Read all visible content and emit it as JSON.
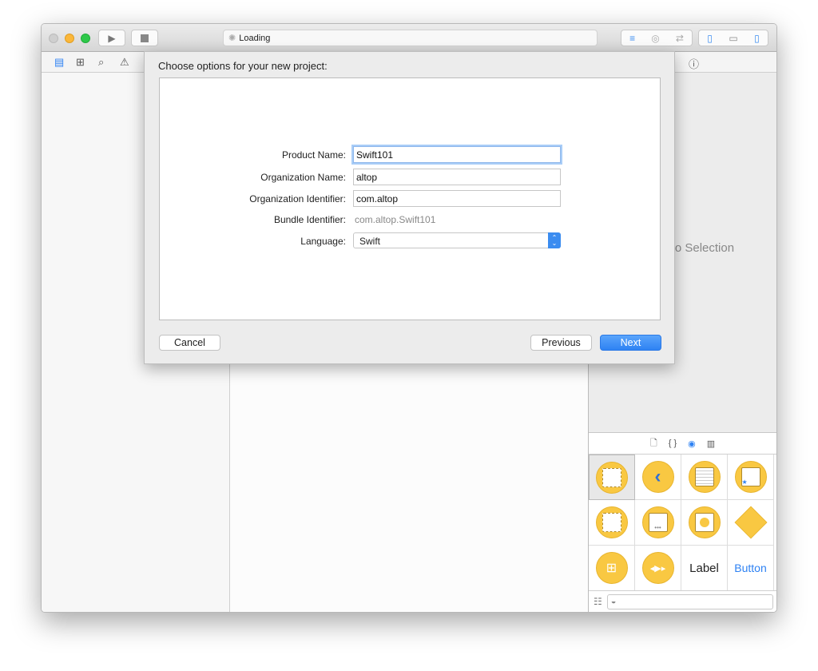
{
  "toolbar": {
    "activity": "Loading"
  },
  "inspector": {
    "empty_text": "No Selection"
  },
  "library": {
    "text_items": [
      "Label",
      "Button"
    ],
    "filter_placeholder": ""
  },
  "sheet": {
    "title": "Choose options for your new project:",
    "fields": {
      "product_name": {
        "label": "Product Name:",
        "value": "Swift101"
      },
      "organization_name": {
        "label": "Organization Name:",
        "value": "altop"
      },
      "organization_identifier": {
        "label": "Organization Identifier:",
        "value": "com.altop"
      },
      "bundle_identifier": {
        "label": "Bundle Identifier:",
        "value": "com.altop.Swift101"
      },
      "language": {
        "label": "Language:",
        "value": "Swift"
      }
    },
    "buttons": {
      "cancel": "Cancel",
      "previous": "Previous",
      "next": "Next"
    }
  },
  "colors": {
    "accent": "#2e82f3",
    "library_icon": "#f9c842"
  }
}
